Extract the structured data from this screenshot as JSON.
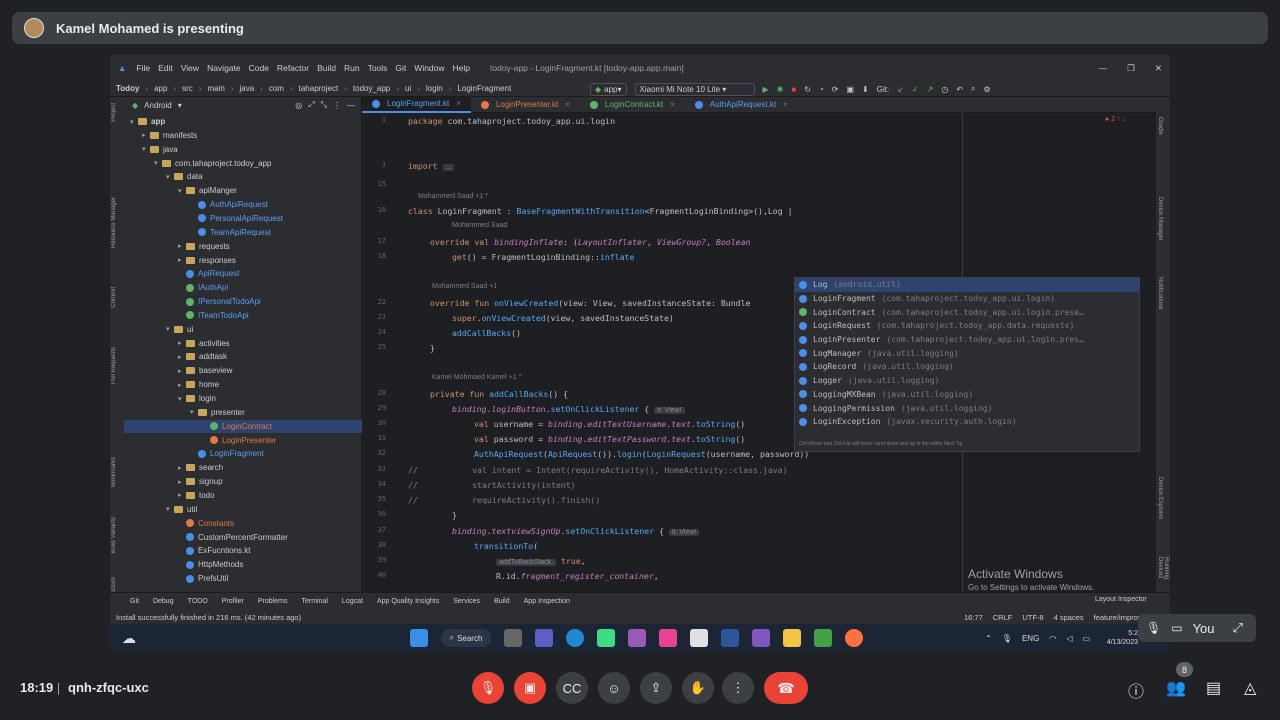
{
  "meet": {
    "presenter": "Kamel Mohamed is presenting",
    "time": "18:19",
    "meeting_code": "qnh-zfqc-uxc",
    "participant_count": "8",
    "self_label": "You"
  },
  "ide": {
    "menu": [
      "File",
      "Edit",
      "View",
      "Navigate",
      "Code",
      "Refactor",
      "Build",
      "Run",
      "Tools",
      "Git",
      "Window",
      "Help"
    ],
    "window_title": "todoy-app - LoginFragment.kt [todoy-app.app.main]",
    "breadcrumbs": [
      "Todoy",
      "app",
      "src",
      "main",
      "java",
      "com",
      "tahaproject",
      "todoy_app",
      "ui",
      "login",
      "LoginFragment"
    ],
    "run_config": "app",
    "device": "Xiaomi Mi Note 10 Lite",
    "git_label": "Git:",
    "project_view": "Android",
    "tabs": [
      "LoginFragment.kt",
      "LoginPresenter.kt",
      "LoginContract.kt",
      "AuthApiRequest.kt"
    ],
    "error_count": "2",
    "tree": [
      {
        "label": "app",
        "indent": 0,
        "type": "folder"
      },
      {
        "label": "manifests",
        "indent": 1,
        "type": "folder"
      },
      {
        "label": "java",
        "indent": 1,
        "type": "folder"
      },
      {
        "label": "com.tahaproject.todoy_app",
        "indent": 2,
        "type": "folder"
      },
      {
        "label": "data",
        "indent": 3,
        "type": "folder"
      },
      {
        "label": "apiManger",
        "indent": 4,
        "type": "folder"
      },
      {
        "label": "AuthApiRequest",
        "indent": 5,
        "type": "kt"
      },
      {
        "label": "PersonalApiRequest",
        "indent": 5,
        "type": "kt"
      },
      {
        "label": "TeamApiRequest",
        "indent": 5,
        "type": "kt"
      },
      {
        "label": "requests",
        "indent": 4,
        "type": "folder"
      },
      {
        "label": "responses",
        "indent": 4,
        "type": "folder"
      },
      {
        "label": "ApiRequest",
        "indent": 4,
        "type": "kt"
      },
      {
        "label": "IAuthApi",
        "indent": 4,
        "type": "ktg"
      },
      {
        "label": "IPersonalTodoApi",
        "indent": 4,
        "type": "ktg"
      },
      {
        "label": "ITeamTodoApi",
        "indent": 4,
        "type": "ktg"
      },
      {
        "label": "ui",
        "indent": 3,
        "type": "folder"
      },
      {
        "label": "activities",
        "indent": 4,
        "type": "folder"
      },
      {
        "label": "addtask",
        "indent": 4,
        "type": "folder"
      },
      {
        "label": "baseview",
        "indent": 4,
        "type": "folder"
      },
      {
        "label": "home",
        "indent": 4,
        "type": "folder"
      },
      {
        "label": "login",
        "indent": 4,
        "type": "folder"
      },
      {
        "label": "presenter",
        "indent": 5,
        "type": "folder"
      },
      {
        "label": "LoginContract",
        "indent": 6,
        "type": "ktg-orange"
      },
      {
        "label": "LoginPresenter",
        "indent": 6,
        "type": "kt-orange"
      },
      {
        "label": "LoginFragment",
        "indent": 5,
        "type": "kt"
      },
      {
        "label": "search",
        "indent": 4,
        "type": "folder"
      },
      {
        "label": "signup",
        "indent": 4,
        "type": "folder"
      },
      {
        "label": "todo",
        "indent": 4,
        "type": "folder"
      },
      {
        "label": "util",
        "indent": 3,
        "type": "folder"
      },
      {
        "label": "Constants",
        "indent": 4,
        "type": "kt-orange"
      },
      {
        "label": "CustomPercentFormatter",
        "indent": 4,
        "type": "kt-plain"
      },
      {
        "label": "ExFucntions.kt",
        "indent": 4,
        "type": "kt-plain"
      },
      {
        "label": "HttpMethods",
        "indent": 4,
        "type": "kt-plain"
      },
      {
        "label": "PrefsUtil",
        "indent": 4,
        "type": "kt-plain"
      }
    ],
    "completion": [
      {
        "name": "Log",
        "pkg": "(android.util)"
      },
      {
        "name": "LoginFragment",
        "pkg": "(com.tahaproject.todoy_app.ui.login)"
      },
      {
        "name": "LoginContract",
        "pkg": "(com.tahaproject.todoy_app.ui.login.prese…"
      },
      {
        "name": "LoginRequest",
        "pkg": "(com.tahaproject.todoy_app.data.requests)"
      },
      {
        "name": "LoginPresenter",
        "pkg": "(com.tahaproject.todoy_app.ui.login.pres…"
      },
      {
        "name": "LogManager",
        "pkg": "(java.util.logging)"
      },
      {
        "name": "LogRecord",
        "pkg": "(java.util.logging)"
      },
      {
        "name": "Logger",
        "pkg": "(java.util.logging)"
      },
      {
        "name": "LoggingMXBean",
        "pkg": "(java.util.logging)"
      },
      {
        "name": "LoggingPermission",
        "pkg": "(java.util.logging)"
      },
      {
        "name": "LoginException",
        "pkg": "(javax.security.auth.login)"
      }
    ],
    "completion_footer": "Ctrl+Down and Ctrl+Up will move caret down and up in the editor  Next Tip",
    "bottom_tools": [
      "Git",
      "Debug",
      "TODO",
      "Profiler",
      "Problems",
      "Terminal",
      "Logcat",
      "App Quality Insights",
      "Services",
      "Build",
      "App Inspection"
    ],
    "layout_inspector": "Layout Inspector",
    "status_message": "Install successfully finished in 216 ms. (42 minutes ago)",
    "status_right": [
      "16:77",
      "CRLF",
      "UTF-8",
      "4 spaces",
      "feature/improve-apis"
    ],
    "activate_title": "Activate Windows",
    "activate_sub": "Go to Settings to activate Windows.",
    "taskbar_search": "Search",
    "lang": "ENG",
    "tray_time": "5:2",
    "tray_date": "4/13/2023"
  }
}
